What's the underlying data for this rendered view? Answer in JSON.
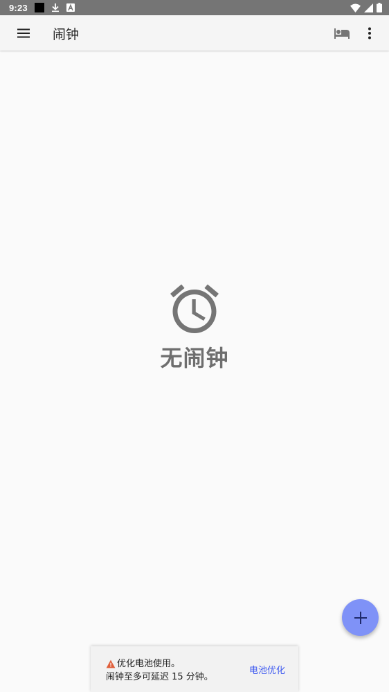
{
  "status_bar": {
    "time": "9:23",
    "icons": [
      "notification-app-icon",
      "download-icon",
      "font-app-icon",
      "wifi-icon",
      "signal-icon",
      "battery-icon"
    ]
  },
  "app_bar": {
    "title": "闹钟",
    "icons": [
      "menu-icon",
      "bed-icon",
      "more-vert-icon"
    ]
  },
  "empty_state": {
    "icon": "alarm-clock-icon",
    "label": "无闹钟"
  },
  "fab": {
    "icon": "plus-icon"
  },
  "snackbar": {
    "icon": "warning-icon",
    "line1": "优化电池使用。",
    "line2": "闹钟至多可延迟 15 分钟。",
    "action": "电池优化"
  },
  "colors": {
    "status_bar": "#757575",
    "app_bar": "#f5f5f5",
    "background": "#fafafa",
    "fab": "#7f92f7",
    "action_text": "#3f5af0",
    "warning": "#e0603c"
  }
}
